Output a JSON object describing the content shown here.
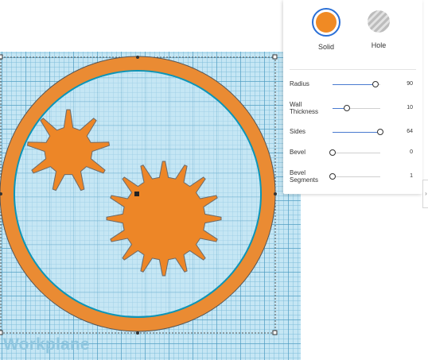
{
  "workplane": {
    "label": "Workplane"
  },
  "material": {
    "solid_label": "Solid",
    "hole_label": "Hole",
    "solid_color": "#f08a24",
    "selected": "Solid"
  },
  "properties": [
    {
      "name": "Radius",
      "value": "90",
      "fraction": 0.9
    },
    {
      "name": "Wall\nThickness",
      "value": "10",
      "fraction": 0.3
    },
    {
      "name": "Sides",
      "value": "64",
      "fraction": 1.0
    },
    {
      "name": "Bevel",
      "value": "0",
      "fraction": 0.0
    },
    {
      "name": "Bevel\nSegments",
      "value": "1",
      "fraction": 0.0
    }
  ],
  "colors": {
    "shape_fill": "#ed8627",
    "ring_fill": "#ea8b33",
    "ring_edge": "#0b95b8",
    "grid": "#c5e6f4"
  },
  "icons": {
    "collapse": "chevron-right-icon"
  }
}
